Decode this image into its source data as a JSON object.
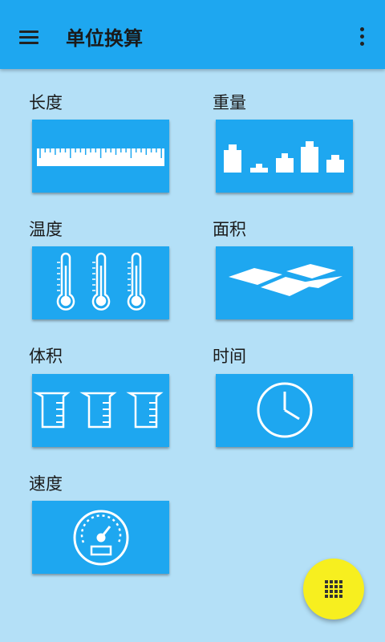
{
  "appbar": {
    "title": "单位换算",
    "menu_icon": "hamburger-menu-icon",
    "more_icon": "more-vert-icon"
  },
  "categories": [
    {
      "label": "长度",
      "icon": "ruler-icon"
    },
    {
      "label": "重量",
      "icon": "weights-icon"
    },
    {
      "label": "温度",
      "icon": "thermometers-icon"
    },
    {
      "label": "面积",
      "icon": "area-tiles-icon"
    },
    {
      "label": "体积",
      "icon": "beakers-icon"
    },
    {
      "label": "时间",
      "icon": "clock-icon"
    },
    {
      "label": "速度",
      "icon": "speedometer-icon"
    }
  ],
  "fab": {
    "icon": "grid-icon"
  },
  "colors": {
    "appbar": "#1ea7f0",
    "background": "#b4e0f7",
    "card": "#1ea7f0",
    "fab": "#f7ef1f"
  }
}
